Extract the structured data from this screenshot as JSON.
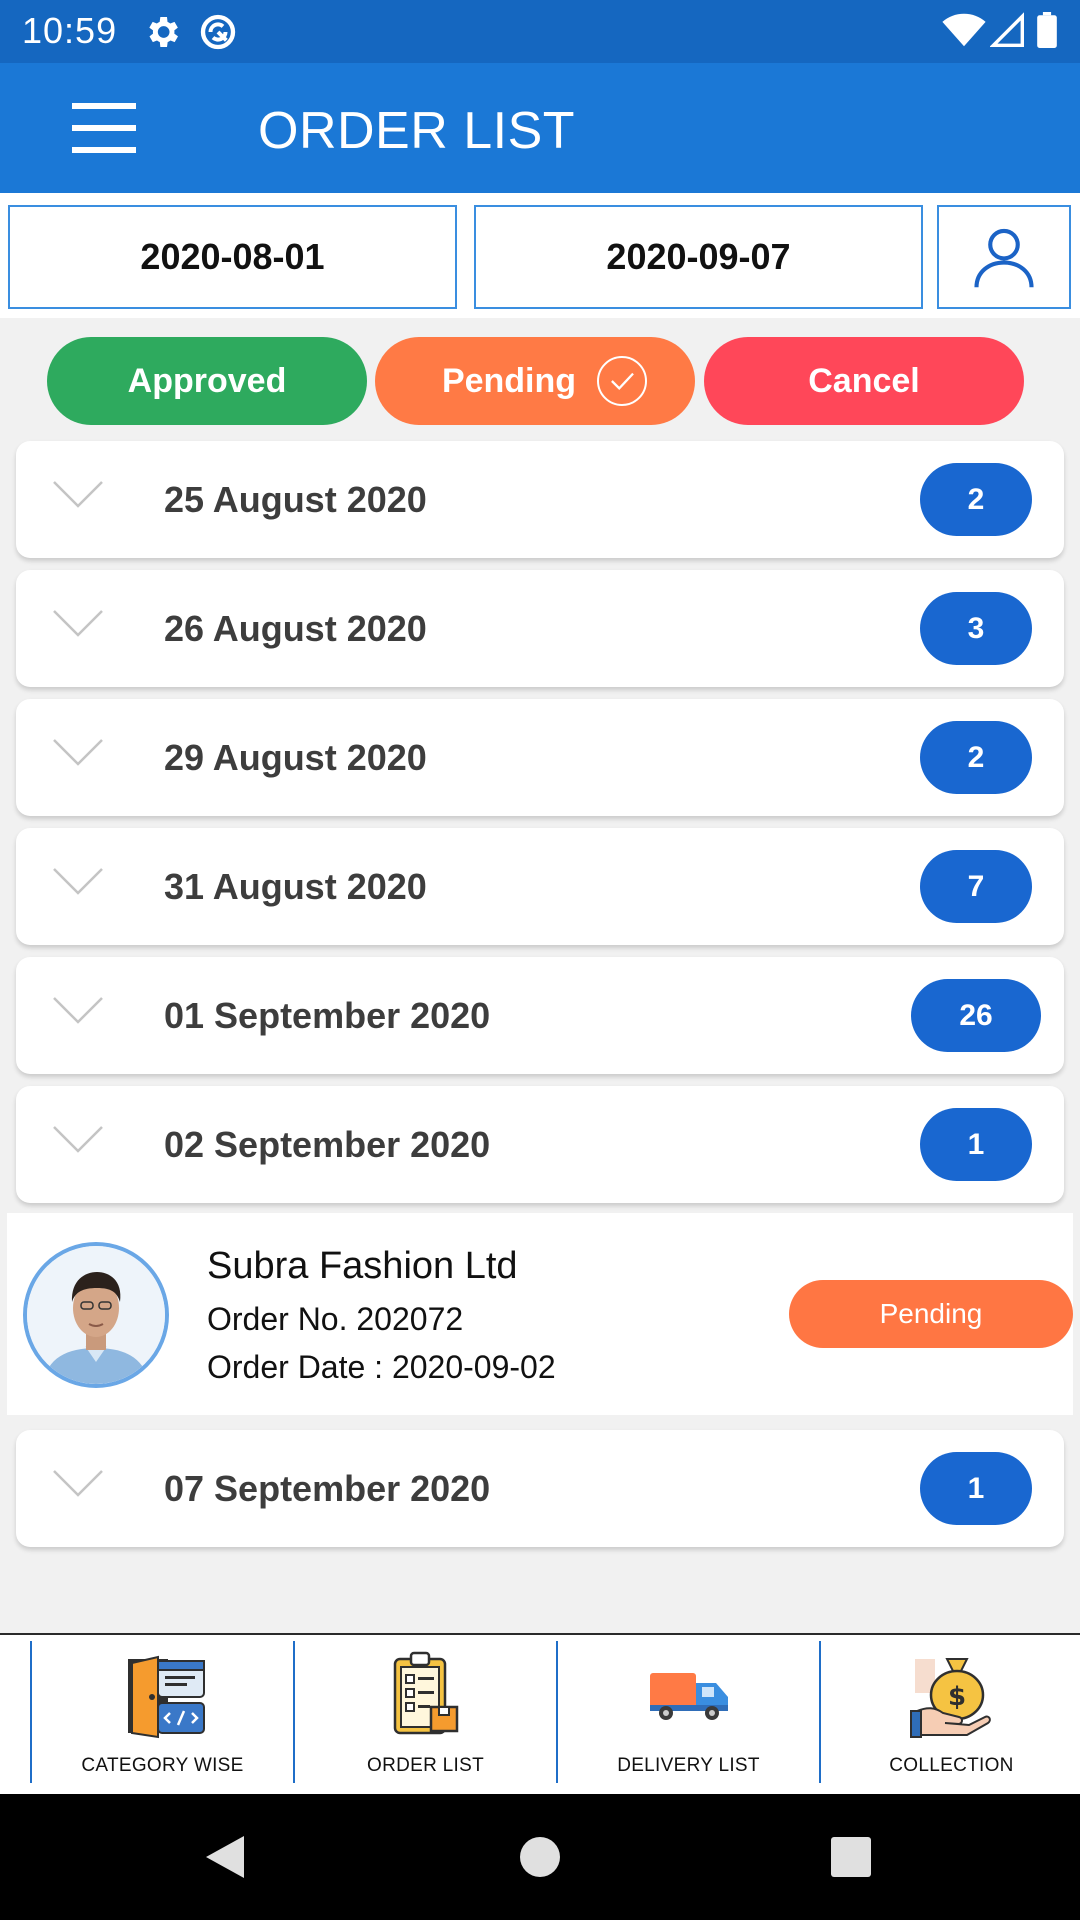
{
  "status_bar": {
    "time": "10:59"
  },
  "header": {
    "title": "ORDER LIST"
  },
  "filters": {
    "from_date": "2020-08-01",
    "to_date": "2020-09-07"
  },
  "status_tabs": {
    "approved": "Approved",
    "pending": "Pending",
    "cancel": "Cancel"
  },
  "colors": {
    "primary": "#1b78d6",
    "approved": "#2eaa5e",
    "pending": "#ff7a45",
    "cancel": "#ff4759",
    "badge": "#1967d0"
  },
  "groups": [
    {
      "date": "25 August 2020",
      "count": "2"
    },
    {
      "date": "26 August 2020",
      "count": "3"
    },
    {
      "date": "29 August 2020",
      "count": "2"
    },
    {
      "date": "31 August 2020",
      "count": "7"
    },
    {
      "date": "01 September 2020",
      "count": "26"
    },
    {
      "date": "02 September 2020",
      "count": "1"
    },
    {
      "date": "07 September 2020",
      "count": "1"
    }
  ],
  "expanded_order": {
    "company": "Subra Fashion Ltd",
    "order_no": "Order No. 202072",
    "order_date": "Order Date : 2020-09-02",
    "status": "Pending"
  },
  "bottom_nav": [
    {
      "label": "CATEGORY WISE",
      "icon": "category-icon"
    },
    {
      "label": "ORDER LIST",
      "icon": "clipboard-icon"
    },
    {
      "label": "DELIVERY LIST",
      "icon": "truck-icon"
    },
    {
      "label": "COLLECTION",
      "icon": "money-bag-icon"
    }
  ]
}
